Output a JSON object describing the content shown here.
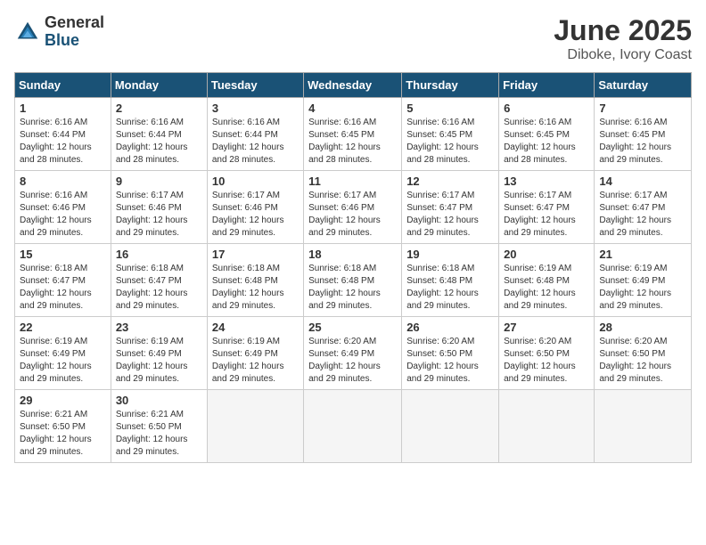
{
  "logo": {
    "general": "General",
    "blue": "Blue"
  },
  "title": "June 2025",
  "location": "Diboke, Ivory Coast",
  "days_of_week": [
    "Sunday",
    "Monday",
    "Tuesday",
    "Wednesday",
    "Thursday",
    "Friday",
    "Saturday"
  ],
  "weeks": [
    [
      {
        "day": "1",
        "info": "Sunrise: 6:16 AM\nSunset: 6:44 PM\nDaylight: 12 hours\nand 28 minutes."
      },
      {
        "day": "2",
        "info": "Sunrise: 6:16 AM\nSunset: 6:44 PM\nDaylight: 12 hours\nand 28 minutes."
      },
      {
        "day": "3",
        "info": "Sunrise: 6:16 AM\nSunset: 6:44 PM\nDaylight: 12 hours\nand 28 minutes."
      },
      {
        "day": "4",
        "info": "Sunrise: 6:16 AM\nSunset: 6:45 PM\nDaylight: 12 hours\nand 28 minutes."
      },
      {
        "day": "5",
        "info": "Sunrise: 6:16 AM\nSunset: 6:45 PM\nDaylight: 12 hours\nand 28 minutes."
      },
      {
        "day": "6",
        "info": "Sunrise: 6:16 AM\nSunset: 6:45 PM\nDaylight: 12 hours\nand 28 minutes."
      },
      {
        "day": "7",
        "info": "Sunrise: 6:16 AM\nSunset: 6:45 PM\nDaylight: 12 hours\nand 29 minutes."
      }
    ],
    [
      {
        "day": "8",
        "info": "Sunrise: 6:16 AM\nSunset: 6:46 PM\nDaylight: 12 hours\nand 29 minutes."
      },
      {
        "day": "9",
        "info": "Sunrise: 6:17 AM\nSunset: 6:46 PM\nDaylight: 12 hours\nand 29 minutes."
      },
      {
        "day": "10",
        "info": "Sunrise: 6:17 AM\nSunset: 6:46 PM\nDaylight: 12 hours\nand 29 minutes."
      },
      {
        "day": "11",
        "info": "Sunrise: 6:17 AM\nSunset: 6:46 PM\nDaylight: 12 hours\nand 29 minutes."
      },
      {
        "day": "12",
        "info": "Sunrise: 6:17 AM\nSunset: 6:47 PM\nDaylight: 12 hours\nand 29 minutes."
      },
      {
        "day": "13",
        "info": "Sunrise: 6:17 AM\nSunset: 6:47 PM\nDaylight: 12 hours\nand 29 minutes."
      },
      {
        "day": "14",
        "info": "Sunrise: 6:17 AM\nSunset: 6:47 PM\nDaylight: 12 hours\nand 29 minutes."
      }
    ],
    [
      {
        "day": "15",
        "info": "Sunrise: 6:18 AM\nSunset: 6:47 PM\nDaylight: 12 hours\nand 29 minutes."
      },
      {
        "day": "16",
        "info": "Sunrise: 6:18 AM\nSunset: 6:47 PM\nDaylight: 12 hours\nand 29 minutes."
      },
      {
        "day": "17",
        "info": "Sunrise: 6:18 AM\nSunset: 6:48 PM\nDaylight: 12 hours\nand 29 minutes."
      },
      {
        "day": "18",
        "info": "Sunrise: 6:18 AM\nSunset: 6:48 PM\nDaylight: 12 hours\nand 29 minutes."
      },
      {
        "day": "19",
        "info": "Sunrise: 6:18 AM\nSunset: 6:48 PM\nDaylight: 12 hours\nand 29 minutes."
      },
      {
        "day": "20",
        "info": "Sunrise: 6:19 AM\nSunset: 6:48 PM\nDaylight: 12 hours\nand 29 minutes."
      },
      {
        "day": "21",
        "info": "Sunrise: 6:19 AM\nSunset: 6:49 PM\nDaylight: 12 hours\nand 29 minutes."
      }
    ],
    [
      {
        "day": "22",
        "info": "Sunrise: 6:19 AM\nSunset: 6:49 PM\nDaylight: 12 hours\nand 29 minutes."
      },
      {
        "day": "23",
        "info": "Sunrise: 6:19 AM\nSunset: 6:49 PM\nDaylight: 12 hours\nand 29 minutes."
      },
      {
        "day": "24",
        "info": "Sunrise: 6:19 AM\nSunset: 6:49 PM\nDaylight: 12 hours\nand 29 minutes."
      },
      {
        "day": "25",
        "info": "Sunrise: 6:20 AM\nSunset: 6:49 PM\nDaylight: 12 hours\nand 29 minutes."
      },
      {
        "day": "26",
        "info": "Sunrise: 6:20 AM\nSunset: 6:50 PM\nDaylight: 12 hours\nand 29 minutes."
      },
      {
        "day": "27",
        "info": "Sunrise: 6:20 AM\nSunset: 6:50 PM\nDaylight: 12 hours\nand 29 minutes."
      },
      {
        "day": "28",
        "info": "Sunrise: 6:20 AM\nSunset: 6:50 PM\nDaylight: 12 hours\nand 29 minutes."
      }
    ],
    [
      {
        "day": "29",
        "info": "Sunrise: 6:21 AM\nSunset: 6:50 PM\nDaylight: 12 hours\nand 29 minutes."
      },
      {
        "day": "30",
        "info": "Sunrise: 6:21 AM\nSunset: 6:50 PM\nDaylight: 12 hours\nand 29 minutes."
      },
      {
        "day": "",
        "info": ""
      },
      {
        "day": "",
        "info": ""
      },
      {
        "day": "",
        "info": ""
      },
      {
        "day": "",
        "info": ""
      },
      {
        "day": "",
        "info": ""
      }
    ]
  ]
}
